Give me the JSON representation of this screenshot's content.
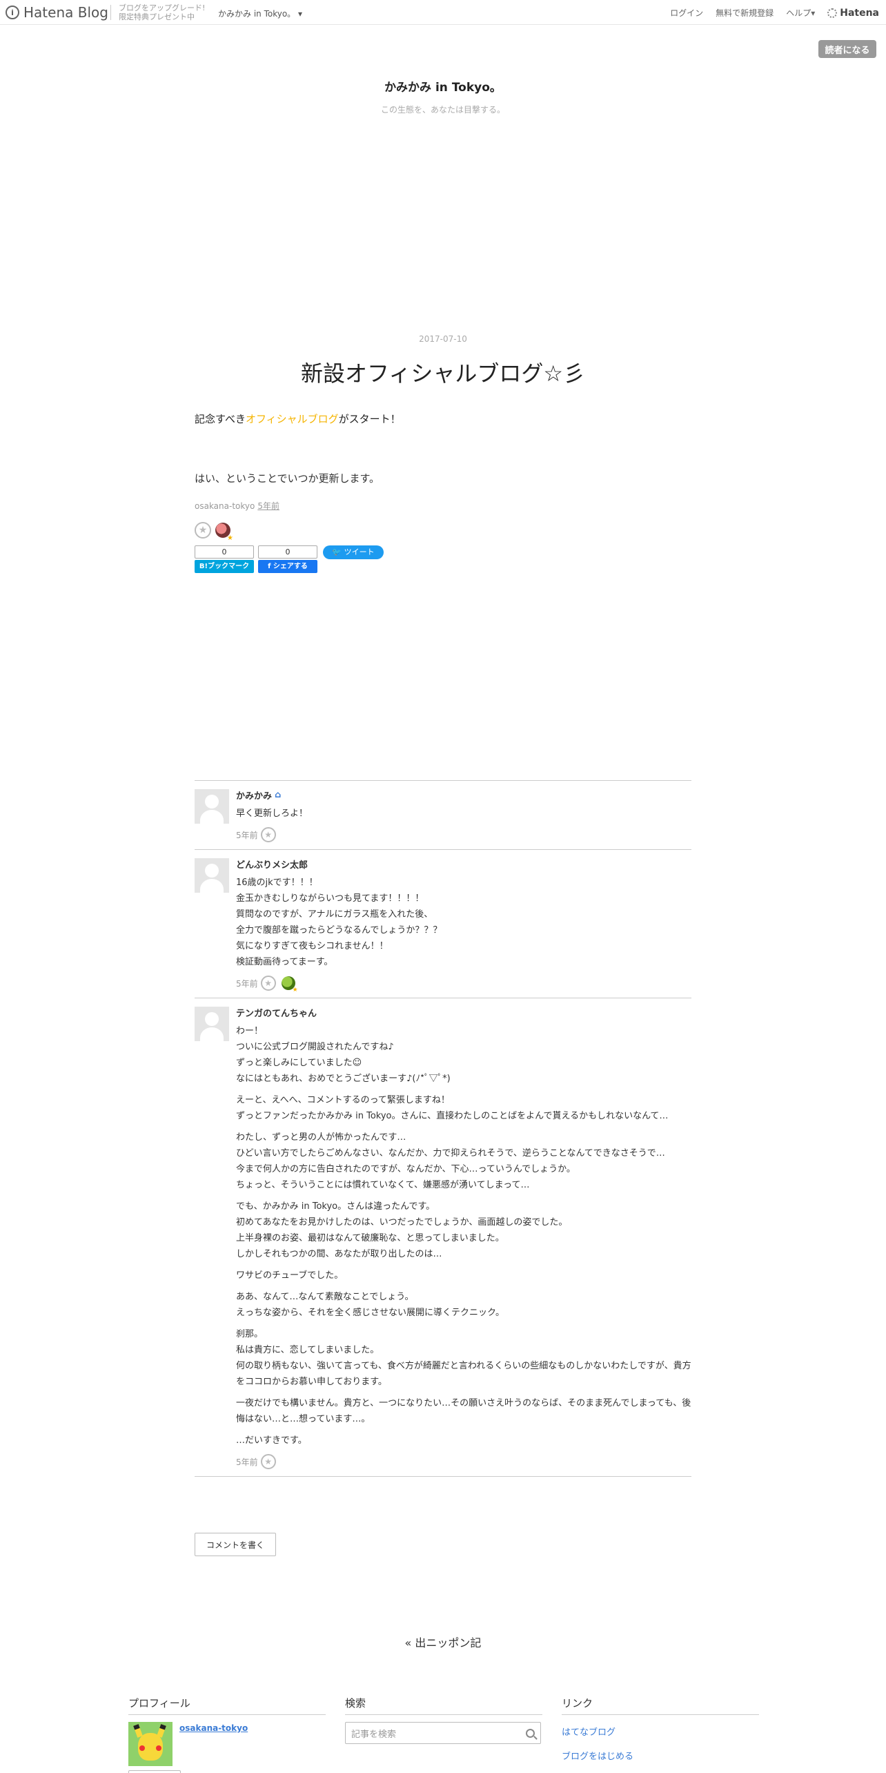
{
  "topbar": {
    "logo": "Hatena Blog",
    "promo_line1": "ブログをアップグレード!",
    "promo_line2": "限定特典プレゼント中",
    "blog_menu": "かみかみ in Tokyo。",
    "login": "ログイン",
    "signup": "無料で新規登録",
    "help": "ヘルプ",
    "hatena": "Hatena"
  },
  "subscribe_label": "読者になる",
  "blog": {
    "title": "かみかみ in Tokyo。",
    "description": "この生態を、あなたは目撃する。"
  },
  "entry": {
    "date": "2017-07-10",
    "title": "新設オフィシャルブログ☆彡",
    "body_prefix": "記念すべき",
    "body_keyword": "オフィシャルブログ",
    "body_suffix": "がスタート！",
    "body_p2": "はい、ということでいつか更新します。",
    "author": "osakana-tokyo",
    "time": "5年前",
    "hatena_count": "0",
    "hatena_label": "B!ブックマーク",
    "facebook_count": "0",
    "facebook_label": "シェアする",
    "tweet_label": "ツイート"
  },
  "comments": [
    {
      "author": "かみかみ",
      "paragraphs": [
        "早く更新しろよ！"
      ],
      "time": "5年前"
    },
    {
      "author": "どんぶりメシ太郎",
      "paragraphs": [
        "16歳のjkです！！！\n金玉かきむしりながらいつも見てます！！！！\n質問なのですが、アナルにガラス瓶を入れた後、\n全力で腹部を蹴ったらどうなるんでしょうか？？？\n気になりすぎて夜もシコれません！！\n検証動画待ってまーす。"
      ],
      "time": "5年前"
    },
    {
      "author": "テンガのてんちゃん",
      "paragraphs": [
        "わー！\nついに公式ブログ開設されたんですね♪\nずっと楽しみにしていました☺\nなにはともあれ、おめでとうございまーす♪(ﾉ*ﾟ▽ﾟ*)",
        "えーと、えへへ、コメントするのって緊張しますね！\nずっとファンだったかみかみ in Tokyo。さんに、直接わたしのことばをよんで貰えるかもしれないなんて…",
        "わたし、ずっと男の人が怖かったんです…\nひどい言い方でしたらごめんなさい、なんだか、力で抑えられそうで、逆らうことなんてできなさそうで…\n今まで何人かの方に告白されたのですが、なんだか、下心…っていうんでしょうか。\nちょっと、そういうことには慣れていなくて、嫌悪感が湧いてしまって…",
        "でも、かみかみ in Tokyo。さんは違ったんです。\n初めてあなたをお見かけしたのは、いつだったでしょうか、画面越しの姿でした。\n上半身裸のお姿、最初はなんて破廉恥な、と思ってしまいました。\nしかしそれもつかの間、あなたが取り出したのは…",
        "ワサビのチューブでした。",
        "ああ、なんて…なんて素敵なことでしょう。\nえっちな姿から、それを全く感じさせない展開に導くテクニック。",
        "刹那。\n私は貴方に、恋してしまいました。\n何の取り柄もない、強いて言っても、食べ方が綺麗だと言われるくらいの些細なものしかないわたしですが、貴方をココロからお慕い申しております。",
        "一夜だけでも構いません。貴方と、一つになりたい…その願いさえ叶うのならば、そのまま死んでしまっても、後悔はない…と…想っています…。",
        "…だいすきです。"
      ],
      "time": "5年前"
    }
  ],
  "write_comment": "コメントを書く",
  "pager_prev": "« 出ニッポン記",
  "sidebar": {
    "profile_title": "プロフィール",
    "profile_name": "osakana-tokyo",
    "search_title": "検索",
    "search_placeholder": "記事を検索",
    "links_title": "リンク",
    "links": [
      "はてなブログ",
      "ブログをはじめる"
    ]
  },
  "colors": {
    "accent_keyword": "#f5b400",
    "link": "#3a7bd5",
    "hatena_bookmark": "#00a4de",
    "facebook": "#1877f2",
    "twitter": "#1d9bf0"
  }
}
